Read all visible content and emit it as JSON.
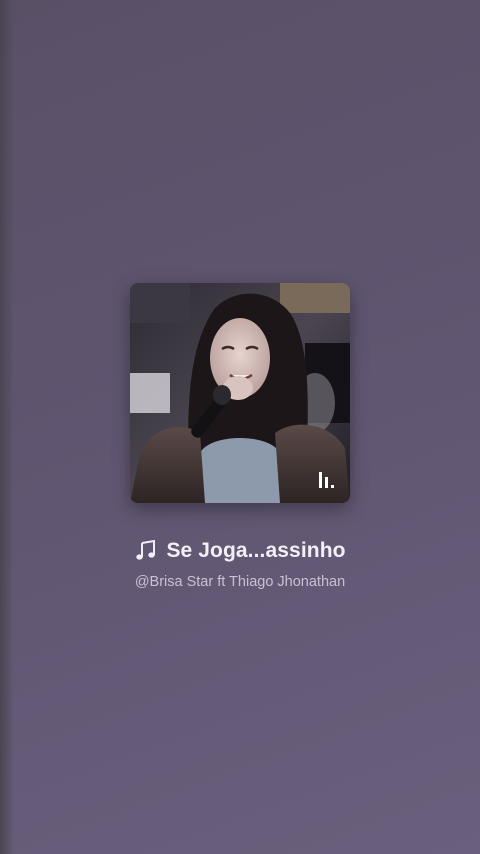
{
  "track": {
    "title": "Se Joga...assinho",
    "artist": "@Brisa Star ft Thiago Jhonathan",
    "note_icon": "music-note-icon",
    "cover_alt": "album-cover"
  },
  "colors": {
    "background_top": "#5a5066",
    "background_bottom": "#6a5f7c",
    "title": "#f3eff7",
    "artist": "#c9c1d3"
  }
}
